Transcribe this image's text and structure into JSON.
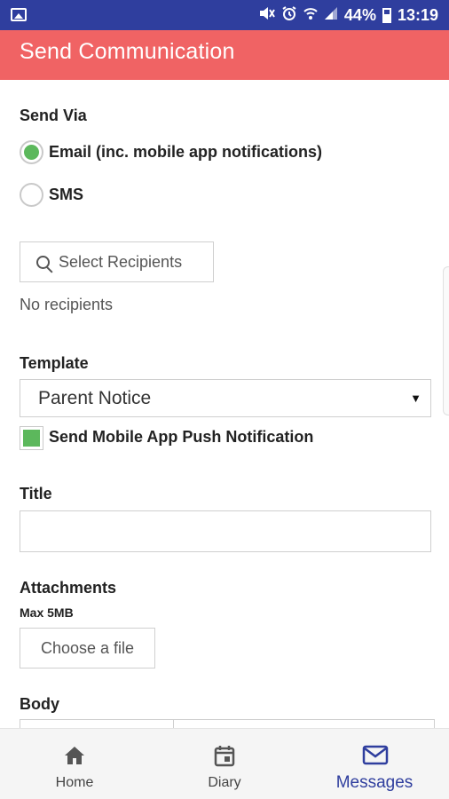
{
  "status_bar": {
    "battery": "44%",
    "time": "13:19",
    "icons": [
      "image-icon",
      "mute-icon",
      "alarm-icon",
      "wifi-icon",
      "signal-icon",
      "battery-icon"
    ]
  },
  "app_bar": {
    "title": "Send Communication",
    "color": "#f06364"
  },
  "form": {
    "send_via": {
      "label": "Send Via",
      "options": [
        {
          "label": "Email (inc. mobile app notifications)",
          "selected": true
        },
        {
          "label": "SMS",
          "selected": false
        }
      ]
    },
    "recipients": {
      "button_label": "Select Recipients",
      "status": "No recipients"
    },
    "template": {
      "label": "Template",
      "selected": "Parent Notice"
    },
    "push_notification": {
      "label": "Send Mobile App Push Notification",
      "checked": true
    },
    "title": {
      "label": "Title",
      "value": ""
    },
    "attachments": {
      "label": "Attachments",
      "hint": "Max 5MB",
      "button_label": "Choose a file"
    },
    "body": {
      "label": "Body"
    }
  },
  "bottom_nav": {
    "items": [
      {
        "label": "Home",
        "icon": "home-icon",
        "active": false
      },
      {
        "label": "Diary",
        "icon": "calendar-icon",
        "active": false
      },
      {
        "label": "Messages",
        "icon": "mail-icon",
        "active": true
      }
    ],
    "active_color": "#2f3e9e"
  },
  "colors": {
    "status_bar": "#2f3e9e",
    "accent_green": "#5cb85c"
  }
}
